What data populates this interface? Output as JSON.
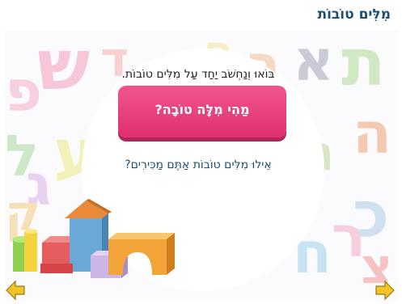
{
  "header": {
    "title": "מִלִּים טוֹבוֹת"
  },
  "content": {
    "intro_text": "בּוֹאוּ וְנַחְשֹׁב יַחַד עַל מִלִּים טוֹבוֹת.",
    "main_button_label": "מַהִי מִלָּה טוֹבָה?",
    "question_text": "אֵילוּ מִלִּים טוֹבוֹת אַתֶּם מַכִּירִים?"
  },
  "navigation": {
    "prev_icon": "arrow-left-icon",
    "next_icon": "arrow-right-icon"
  },
  "background": {
    "letters": [
      "ש",
      "א",
      "ת",
      "ב",
      "ה",
      "ע",
      "פ",
      "ל",
      "ג",
      "כ",
      "ח",
      "ר",
      "נ",
      "ד",
      "ס",
      "צ",
      "ק"
    ]
  },
  "colors": {
    "title": "#1c4f73",
    "primary_button": "#e8437d",
    "nav_arrow": "#f2c428"
  }
}
